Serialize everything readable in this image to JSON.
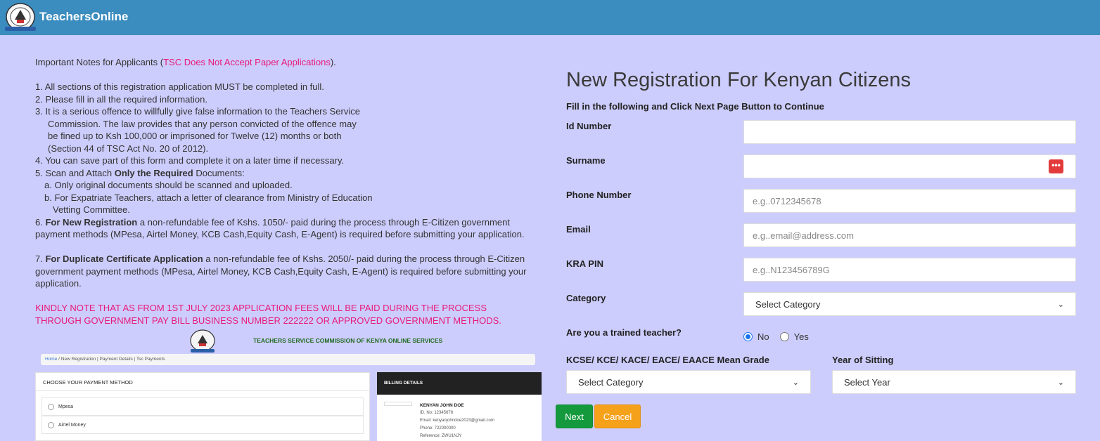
{
  "header": {
    "brand": "TeachersOnline"
  },
  "notes": {
    "intro_prefix": "Important Notes for Applicants (",
    "intro_highlight": "TSC Does Not Accept Paper Applications",
    "intro_suffix": ").",
    "item1": "1.  All sections of this registration application MUST be completed in full.",
    "item2": "2.  Please fill in all the required information.",
    "item3_l1": "3.  It is a serious offence to willfully give false information to the Teachers Service",
    "item3_l2": "Commission. The law provides that any person convicted of the offence may",
    "item3_l3": "be fined up to Ksh 100,000 or imprisoned for Twelve (12) months or both",
    "item3_l4": "(Section 44 of TSC Act No. 20 of 2012).",
    "item4": "4.  You can save part of this form and complete it on a later time if necessary.",
    "item5_prefix": "5.  Scan and Attach ",
    "item5_bold": "Only the  Required",
    "item5_suffix": " Documents:",
    "item5a": "a. Only original documents should be scanned and uploaded.",
    "item5b_l1": "b. For Expatriate Teachers, attach a letter of clearance from Ministry of Education",
    "item5b_l2": "Vetting Committee.",
    "item6_prefix": "6.  ",
    "item6_bold": "For New Registration",
    "item6_rest": " a non-refundable fee of Kshs. 1050/- paid during the process through E-Citizen government payment methods (MPesa, Airtel Money, KCB Cash,Equity Cash, E-Agent) is required before submitting your application.",
    "item7_prefix": "7.  ",
    "item7_bold": "For Duplicate Certificate Application",
    "item7_rest": " a non-refundable fee of Kshs. 2050/- paid during the process through E-Citizen government payment methods (MPesa, Airtel Money, KCB Cash,Equity Cash, E-Agent) is required before submitting your application.",
    "warning": "KINDLY NOTE THAT AS FROM 1ST JULY 2023 APPLICATION FEES WILL BE PAID DURING THE PROCESS THROUGH GOVERNMENT PAY BILL BUSINESS NUMBER 222222 OR APPROVED GOVERNMENT METHODS."
  },
  "embedded": {
    "title": "TEACHERS SERVICE COMMISSION OF KENYA ONLINE SERVICES",
    "bread_home": "Home",
    "bread_rest": "  /  New Registration | Payment Details | Tsc Payments",
    "pay_heading": "CHOOSE YOUR PAYMENT METHOD",
    "opt1": "Mpesa",
    "opt2": "Airtel Money",
    "bill_heading": "BILLING DETAILS",
    "bill_name": "KENYAN JOHN DOE",
    "bill_id": "ID. No: 12345678",
    "bill_email": "Email: kenyanjohndoe2023@gmail.com",
    "bill_phone": "Phone: 722000000",
    "bill_ref": "Reference: ZWU1NJY"
  },
  "form": {
    "title": "New Registration For Kenyan Citizens",
    "subtitle": "Fill in the following and Click Next Page Button to Continue",
    "id_label": "Id Number",
    "surname_label": "Surname",
    "phone_label": "Phone Number",
    "phone_placeholder": "e.g..0712345678",
    "email_label": "Email",
    "email_placeholder": "e.g..email@address.com",
    "kra_label": "KRA PIN",
    "kra_placeholder": "e.g..N123456789G",
    "category_label": "Category",
    "category_value": "Select Category",
    "trained_label": "Are you a trained teacher?",
    "trained_no": "No",
    "trained_yes": "Yes",
    "trained_selected": "No",
    "grade_label": "KCSE/ KCE/ KACE/ EACE/ EAACE Mean Grade",
    "grade_value": "Select Category",
    "year_label": "Year of Sitting",
    "year_value": "Select Year",
    "next_label": "Next",
    "cancel_label": "Cancel"
  },
  "colors": {
    "header": "#3b8cbf",
    "background": "#cdcdfd",
    "accent_pink": "#e8197a",
    "next_button": "#149a3d",
    "cancel_button": "#f5a11a"
  }
}
